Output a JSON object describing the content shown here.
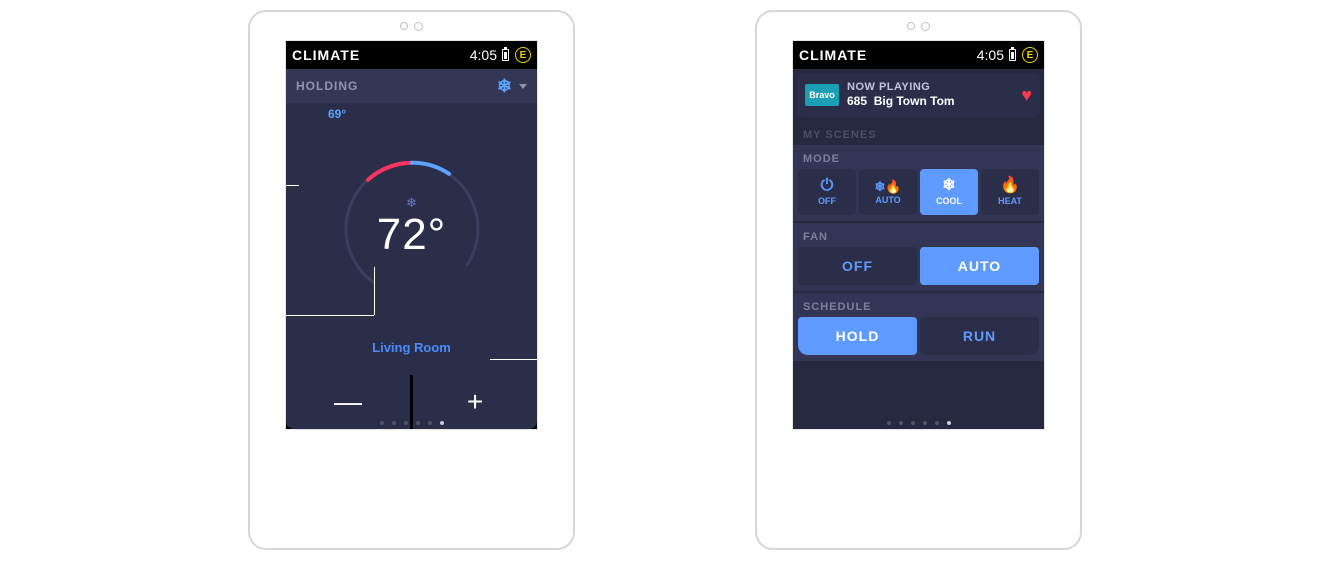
{
  "status": {
    "title": "CLIMATE",
    "time": "4:05",
    "badge": "E"
  },
  "screen1": {
    "holding_label": "HOLDING",
    "setpoint": "69°",
    "temperature": "72°",
    "room": "Living Room",
    "minus": "—",
    "plus": "+"
  },
  "screen2": {
    "now_playing": {
      "logo": "Bravo",
      "label": "NOW PLAYING",
      "channel": "685",
      "title": "Big Town Tom"
    },
    "my_scenes_label": "MY SCENES",
    "mode": {
      "label": "MODE",
      "options": [
        {
          "name": "OFF",
          "icon": "⏻"
        },
        {
          "name": "AUTO",
          "icon": "❄🔥"
        },
        {
          "name": "COOL",
          "icon": "❄"
        },
        {
          "name": "HEAT",
          "icon": "🔥"
        }
      ],
      "active": "COOL"
    },
    "fan": {
      "label": "FAN",
      "options": [
        "OFF",
        "AUTO"
      ],
      "active": "AUTO"
    },
    "schedule": {
      "label": "SCHEDULE",
      "options": [
        "HOLD",
        "RUN"
      ],
      "active": "HOLD"
    }
  }
}
